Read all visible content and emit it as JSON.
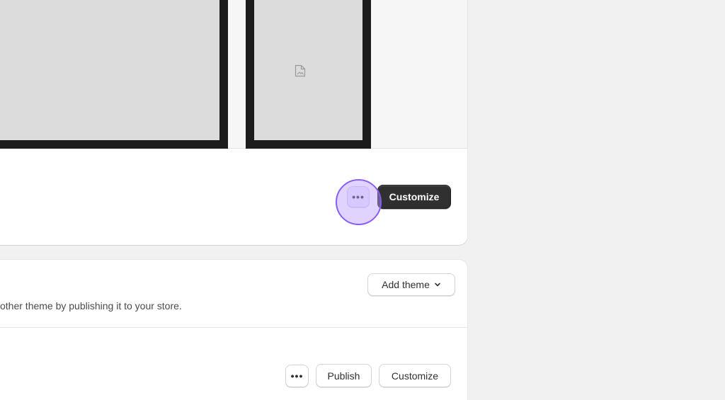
{
  "current_theme": {
    "more_label": "•••",
    "customize_label": "Customize"
  },
  "theme_library": {
    "add_theme_label": "Add theme",
    "description": "other theme by publishing it to your store.",
    "more_label": "•••",
    "publish_label": "Publish",
    "customize_label": "Customize"
  },
  "icons": {
    "placeholder": "image-placeholder-icon",
    "more": "ellipsis-icon",
    "chevron": "chevron-down-icon"
  },
  "colors": {
    "background": "#f1f1f1",
    "primary_button": "#303030",
    "highlight": "#8a5cf6"
  }
}
